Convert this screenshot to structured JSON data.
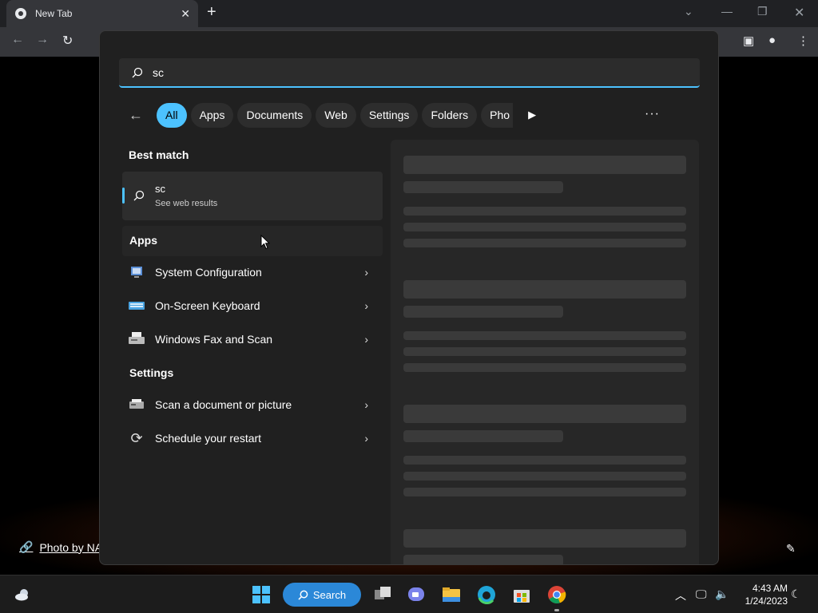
{
  "browser": {
    "tab_title": "New Tab",
    "photo_credit": "Photo by NA"
  },
  "search": {
    "query": "sc"
  },
  "filters": [
    "All",
    "Apps",
    "Documents",
    "Web",
    "Settings",
    "Folders",
    "Pho"
  ],
  "sections": {
    "best_match": "Best match",
    "apps": "Apps",
    "settings": "Settings"
  },
  "best_match": {
    "title": "sc",
    "subtitle": "See web results"
  },
  "apps": [
    {
      "label": "System Configuration"
    },
    {
      "label": "On-Screen Keyboard"
    },
    {
      "label": "Windows Fax and Scan"
    }
  ],
  "settings": [
    {
      "label": "Scan a document or picture"
    },
    {
      "label": "Schedule your restart"
    }
  ],
  "taskbar": {
    "search_label": "Search",
    "time": "4:43 AM",
    "date": "1/24/2023"
  },
  "colors": {
    "accent": "#4cc2ff",
    "panel_bg": "#202020",
    "taskbar_bg": "#1c1c1c"
  }
}
